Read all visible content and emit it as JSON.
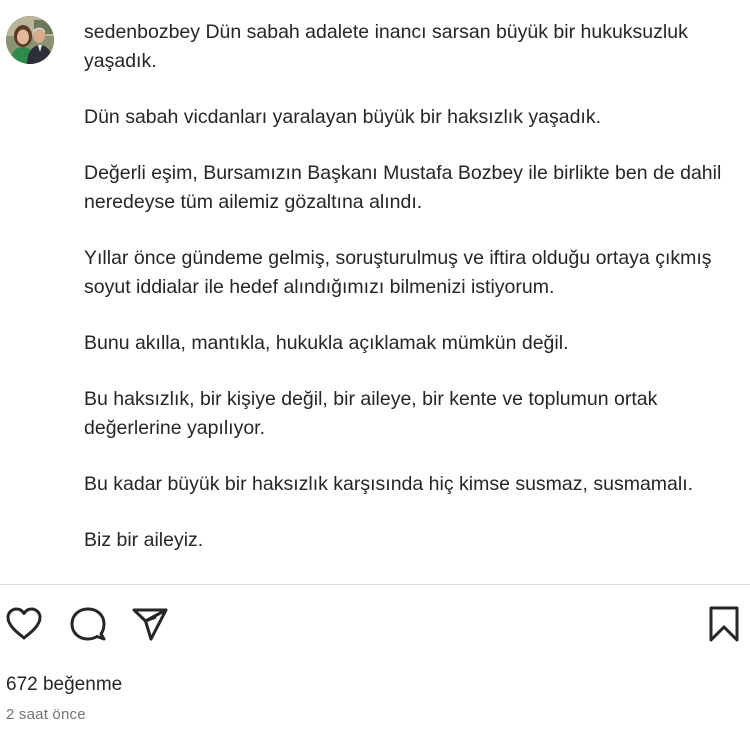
{
  "post": {
    "username": "sedenbozbey",
    "avatar_icon": "profile-photo-avatar",
    "caption": {
      "first_line": "Dün sabah adalete inancı sarsan büyük bir hukuksuzluk yaşadık.",
      "paragraphs": [
        "Dün sabah vicdanları yaralayan büyük bir haksızlık yaşadık.",
        "Değerli eşim, Bursamızın Başkanı Mustafa Bozbey ile birlikte ben de dahil neredeyse tüm ailemiz gözaltına alındı.",
        "Yıllar önce gündeme gelmiş, soruşturulmuş ve iftira olduğu ortaya çıkmış soyut iddialar ile hedef alındığımızı bilmenizi istiyorum.",
        "Bunu akılla, mantıkla, hukukla açıklamak mümkün değil.",
        "Bu haksızlık, bir kişiye değil, bir aileye, bir kente ve toplumun ortak değerlerine yapılıyor.",
        "Bu kadar büyük bir haksızlık karşısında hiç kimse susmaz, susmamalı.",
        "Biz bir aileyiz."
      ]
    }
  },
  "actions": {
    "like_icon": "heart-icon",
    "comment_icon": "comment-icon",
    "share_icon": "share-icon",
    "save_icon": "bookmark-icon"
  },
  "stats": {
    "likes": "672 beğenme",
    "time_ago": "2 saat önce"
  },
  "colors": {
    "text": "#262626",
    "secondary_text": "#737373",
    "divider": "#dbdbdb",
    "background": "#ffffff"
  }
}
